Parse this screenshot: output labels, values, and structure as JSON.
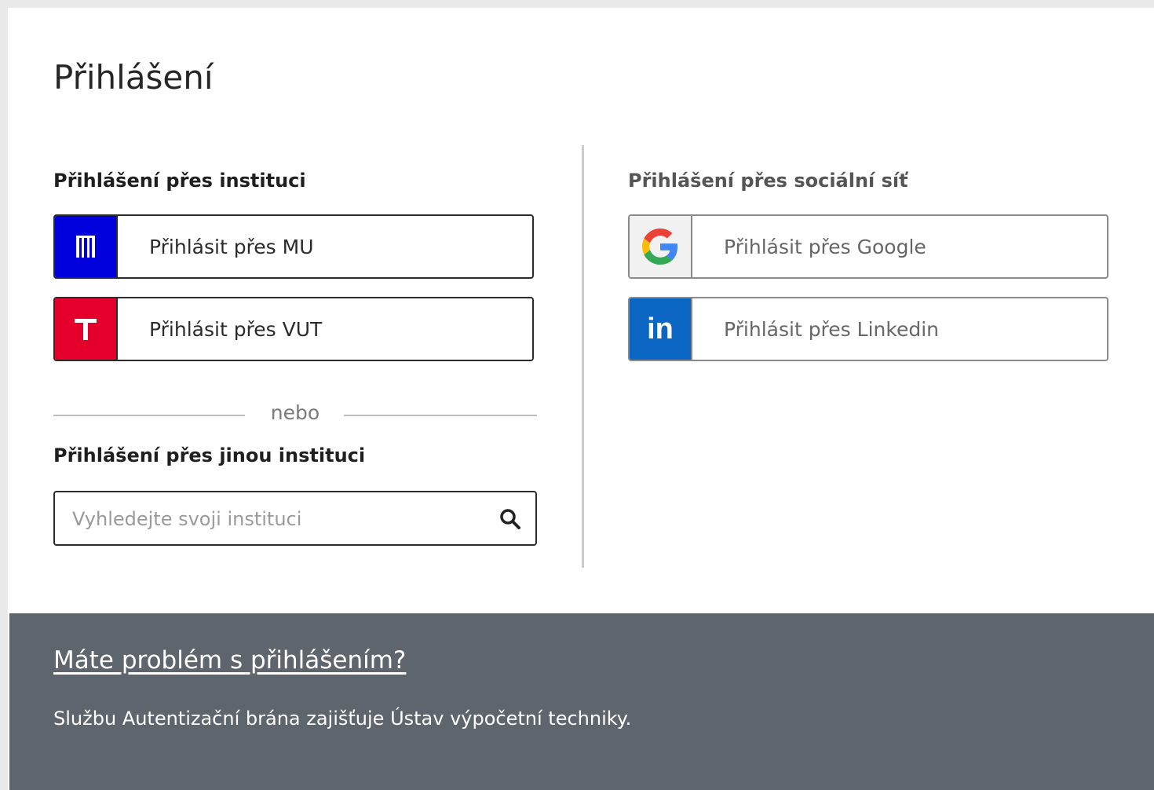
{
  "page": {
    "title": "Přihlášení"
  },
  "institution": {
    "heading": "Přihlášení přes instituci",
    "buttons": [
      {
        "label": "Přihlásit přes MU",
        "icon": "mu-logo-icon",
        "icon_text": "M",
        "color": "#0000dc"
      },
      {
        "label": "Přihlásit přes VUT",
        "icon": "vut-logo-icon",
        "icon_text": "T",
        "color": "#e4002b"
      }
    ],
    "separator": "nebo"
  },
  "other_institution": {
    "heading": "Přihlášení přes jinou instituci",
    "search_placeholder": "Vyhledejte svoji instituci",
    "search_value": ""
  },
  "social": {
    "heading": "Přihlášení přes sociální síť",
    "buttons": [
      {
        "label": "Přihlásit přes Google",
        "icon": "google-logo-icon",
        "color": "#f1f1f1"
      },
      {
        "label": "Přihlásit přes Linkedin",
        "icon": "linkedin-logo-icon",
        "icon_text": "in",
        "color": "#0a66c2"
      }
    ]
  },
  "footer": {
    "help_link": "Máte problém s přihlášením?",
    "text": "Službu Autentizační brána zajišťuje Ústav výpočetní techniky.",
    "background": "#5f656c"
  }
}
